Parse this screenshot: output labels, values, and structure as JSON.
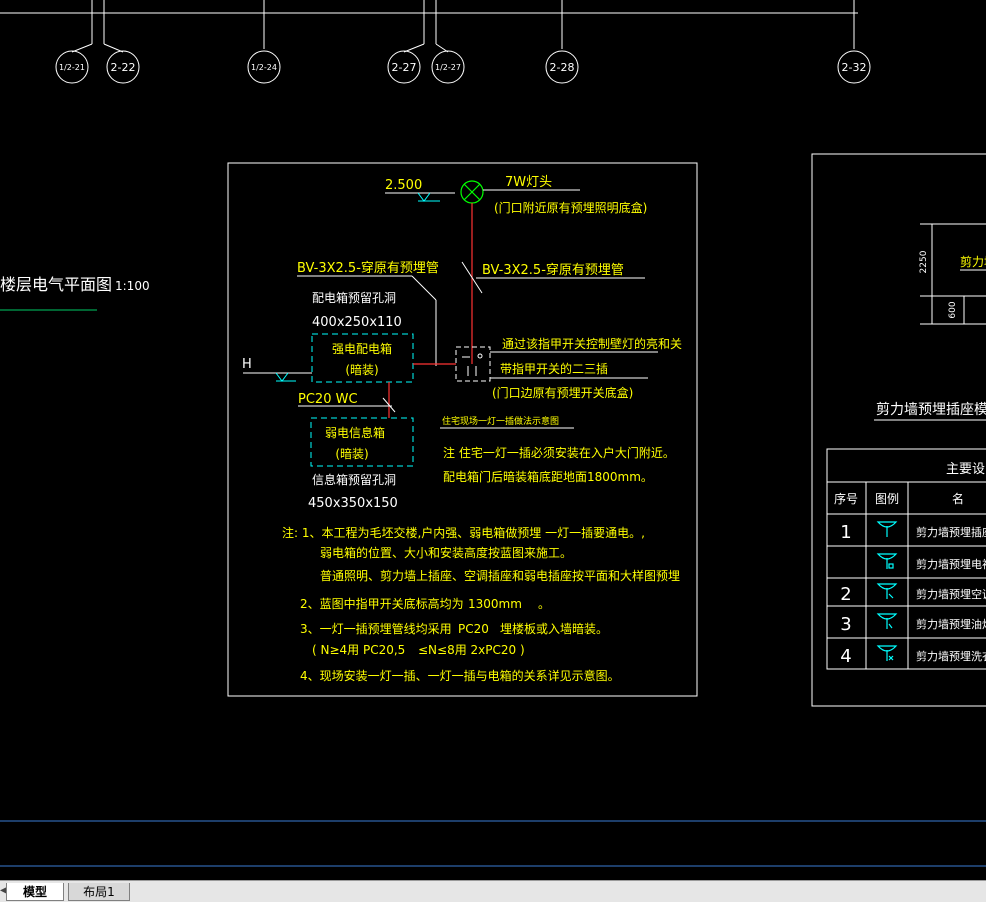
{
  "axes": [
    "1/2-21",
    "2-22",
    "1/2-24",
    "2-27",
    "1/2-27",
    "2-28",
    "2-32"
  ],
  "drawing": {
    "title": "楼层电气平面图",
    "scale": "1:100"
  },
  "detail": {
    "elev_top": "2.500",
    "lamp": "7W灯头",
    "lamp_note": "(门口附近原有预埋照明底盒)",
    "wire_left": "BV-3X2.5-穿原有预埋管",
    "wire_right": "BV-3X2.5-穿原有预埋管",
    "dist_hole": "配电箱预留孔洞",
    "dist_hole_size": "400x250x110",
    "strong_box": "强电配电箱",
    "strong_box_mode": "(暗装)",
    "level_h": "H",
    "pc20": "PC20 WC",
    "weak_box": "弱电信息箱",
    "weak_box_mode": "(暗装)",
    "info_hole": "信息箱预留孔洞",
    "info_hole_size": "450x350x150",
    "switch_note1": "通过该指甲开关控制壁灯的亮和关",
    "switch_note2": "带指甲开关的二三插",
    "switch_note3": "(门口边原有预埋开关底盒)",
    "diagram_title": "住宅现场一灯一插做法示意图",
    "install_note1": "注 住宅一灯一插必须安装在入户大门附近。",
    "install_note2": "配电箱门后暗装箱底距地面1800mm。",
    "notes": [
      "注: 1、本工程为毛坯交楼,户内强、弱电箱做预埋 一灯一插要通电。,",
      "弱电箱的位置、大小和安装高度按蓝图来施工。",
      "普通照明、剪力墙上插座、空调插座和弱电插座按平面和大样图预埋",
      "2、蓝图中指甲开关底标高均为",
      "1300mm",
      "。",
      "3、一灯一插预埋管线均采用",
      "PC20",
      "埋楼板或入墙暗装。",
      "( N≥4用 PC20,5",
      "≤N≤8用 2xPC20 )",
      "4、现场安装一灯一插、一灯一插与电箱的关系详见示意图。"
    ]
  },
  "right_panel": {
    "dim_2250": "2250",
    "dim_600": "600",
    "socket_label": "剪力墙",
    "model_title": "剪力墙预埋插座模型",
    "table_title": "主要设",
    "headers": [
      "序号",
      "图例",
      "名"
    ],
    "rows": [
      {
        "no": "1",
        "name": "剪力墙预埋插座"
      },
      {
        "no": "",
        "name": "剪力墙预埋电视"
      },
      {
        "no": "2",
        "name": "剪力墙预埋空调"
      },
      {
        "no": "3",
        "name": "剪力墙预埋油烟"
      },
      {
        "no": "4",
        "name": "剪力墙预埋洗衣"
      }
    ]
  },
  "tabs": {
    "model": "模型",
    "layout1": "布局1"
  }
}
